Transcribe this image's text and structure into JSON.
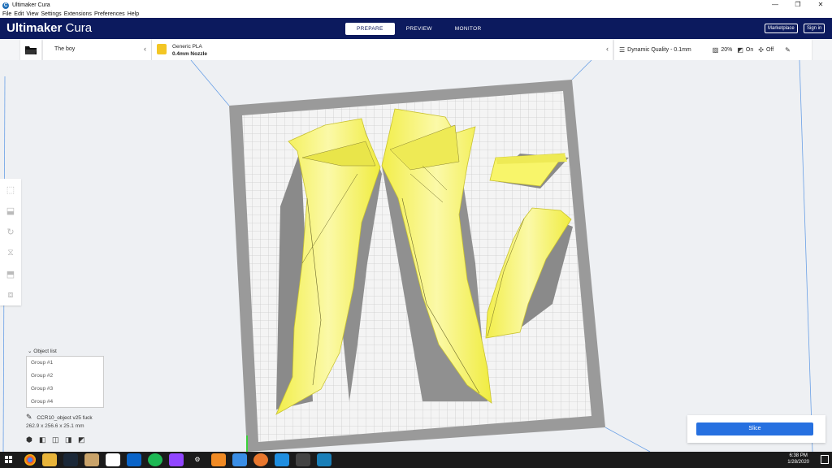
{
  "window": {
    "title": "Ultimaker Cura",
    "controls": [
      "—",
      "❐",
      "✕"
    ]
  },
  "menu": [
    "File",
    "Edit",
    "View",
    "Settings",
    "Extensions",
    "Preferences",
    "Help"
  ],
  "header": {
    "logo_bold": "Ultimaker",
    "logo_light": "Cura",
    "stages": [
      "PREPARE",
      "PREVIEW",
      "MONITOR"
    ],
    "active_stage": "PREPARE",
    "marketplace": "Marketplace",
    "sign_in": "Sign in"
  },
  "job": {
    "name": "The boy"
  },
  "printer": {
    "material": "Generic PLA",
    "nozzle": "0.4mm Nozzle"
  },
  "print_settings": {
    "profile": "Dynamic Quality - 0.1mm",
    "infill": "20%",
    "support": "On",
    "adhesion": "Off"
  },
  "object_list": {
    "title": "Object list",
    "items": [
      "Group #1",
      "Group #2",
      "Group #3",
      "Group #4"
    ],
    "object_name": "CCR10_object v25 fuck",
    "dimensions": "262.9 x 256.6 x 25.1 mm"
  },
  "slice": {
    "button": "Slice"
  },
  "taskbar": {
    "time": "6:38 PM",
    "date": "1/28/2020",
    "icons": [
      "chrome",
      "file-explorer",
      "steam",
      "app",
      "notepad",
      "outlook",
      "spotify",
      "twitch",
      "settings",
      "fusion",
      "store",
      "blender",
      "cura",
      "app2",
      "app3"
    ]
  },
  "colors": {
    "header": "#0c1a5e",
    "model": "#f8f56a",
    "plate": "#f1f1f1",
    "accent": "#2670e0"
  }
}
